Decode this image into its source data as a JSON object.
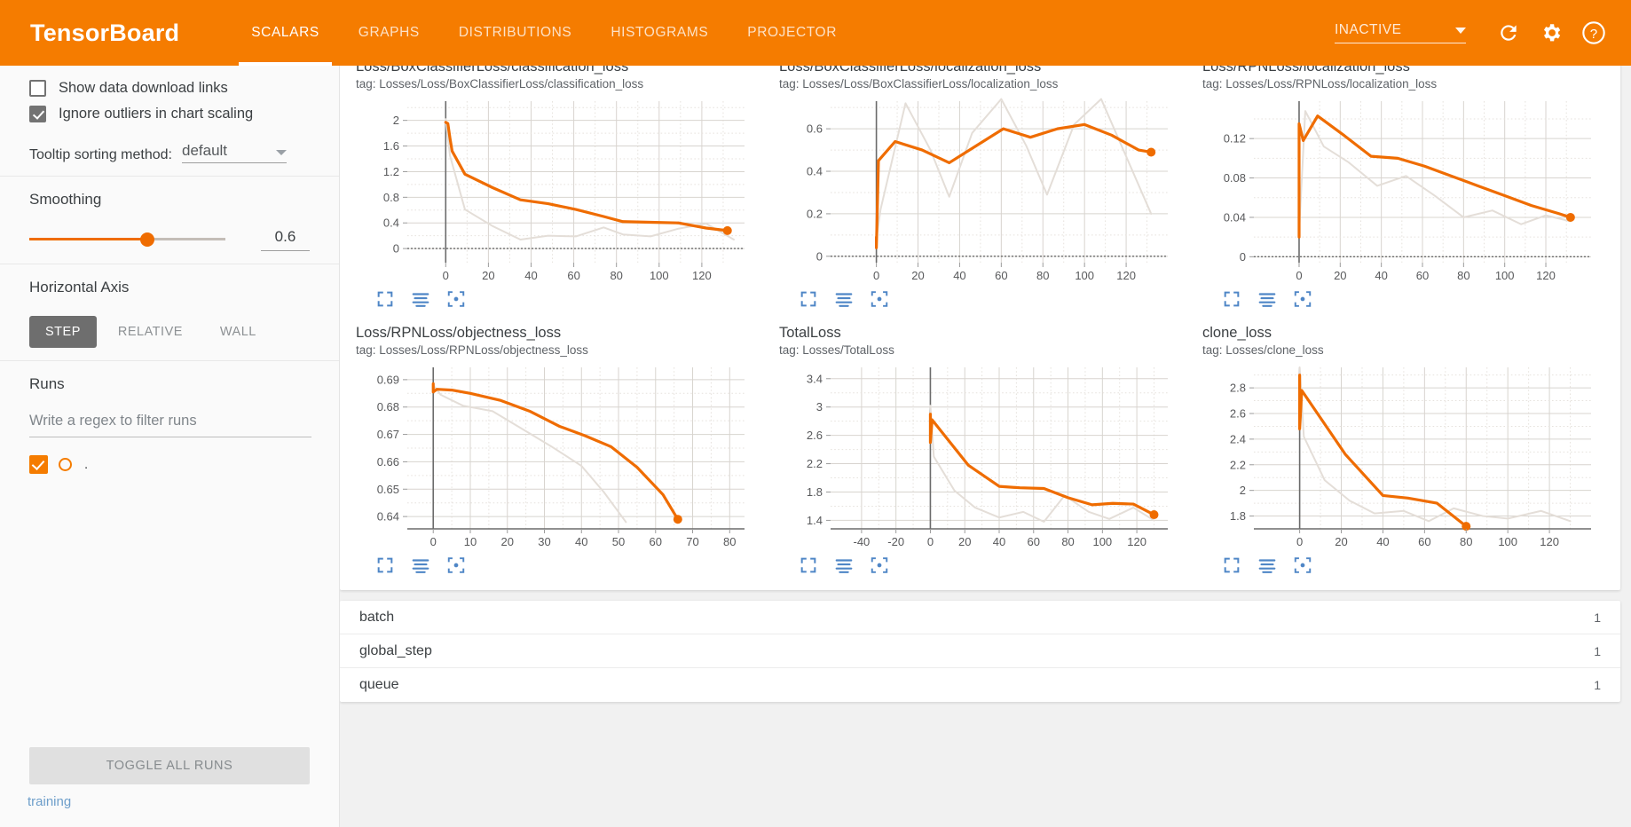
{
  "app": {
    "brand": "TensorBoard",
    "accent": "#f57c00",
    "line_color": "#ef6c00"
  },
  "header": {
    "tabs": [
      {
        "label": "SCALARS",
        "active": true
      },
      {
        "label": "GRAPHS",
        "active": false
      },
      {
        "label": "DISTRIBUTIONS",
        "active": false
      },
      {
        "label": "HISTOGRAMS",
        "active": false
      },
      {
        "label": "PROJECTOR",
        "active": false
      }
    ],
    "status_select": {
      "value": "INACTIVE",
      "icon": "chevron-down-icon"
    },
    "refresh_icon": "refresh-icon",
    "settings_icon": "gear-icon",
    "help_icon": "help-icon"
  },
  "sidebar": {
    "show_data_download_links": {
      "label": "Show data download links",
      "checked": false
    },
    "ignore_outliers": {
      "label": "Ignore outliers in chart scaling",
      "checked": true
    },
    "tooltip_sorting": {
      "label": "Tooltip sorting method:",
      "value": "default"
    },
    "smoothing": {
      "title": "Smoothing",
      "value": "0.6",
      "percent": 60
    },
    "horizontal_axis": {
      "title": "Horizontal Axis",
      "options": [
        {
          "label": "STEP",
          "active": true
        },
        {
          "label": "RELATIVE",
          "active": false
        },
        {
          "label": "WALL",
          "active": false
        }
      ]
    },
    "runs": {
      "title": "Runs",
      "filter_placeholder": "Write a regex to filter runs",
      "filter_value": "",
      "items": [
        {
          "name": ".",
          "checked": true
        }
      ],
      "toggle_all_label": "TOGGLE ALL RUNS",
      "training_link": "training"
    }
  },
  "chart_data": [
    {
      "type": "line",
      "title": "Loss/BoxClassifierLoss/classification_loss",
      "tag": "tag: Losses/Loss/BoxClassifierLoss/classification_loss",
      "xlabel": "",
      "ylabel": "",
      "xticks": [
        0,
        20,
        40,
        60,
        80,
        100,
        120
      ],
      "yticks": [
        0,
        0.4,
        0.8,
        1.2,
        1.6,
        2
      ],
      "xlim": [
        -18,
        140
      ],
      "ylim": [
        -0.22,
        2.3
      ],
      "grid": true,
      "legend": "none",
      "series": [
        {
          "name": "smoothed",
          "style": "solid",
          "x": [
            0,
            1,
            2,
            3,
            9,
            22,
            35,
            48,
            61,
            74,
            83,
            96,
            109,
            122,
            132
          ],
          "values": [
            1.97,
            1.95,
            1.72,
            1.52,
            1.16,
            0.95,
            0.76,
            0.7,
            0.61,
            0.5,
            0.42,
            0.41,
            0.4,
            0.32,
            0.28
          ]
        },
        {
          "name": "raw",
          "style": "faded",
          "x": [
            0,
            2,
            9,
            22,
            35,
            48,
            61,
            74,
            83,
            96,
            109,
            122,
            135
          ],
          "values": [
            2.02,
            1.45,
            0.61,
            0.35,
            0.14,
            0.2,
            0.19,
            0.33,
            0.22,
            0.19,
            0.31,
            0.39,
            0.14
          ]
        }
      ]
    },
    {
      "type": "line",
      "title": "Loss/BoxClassifierLoss/localization_loss",
      "tag": "tag: Losses/Loss/BoxClassifierLoss/localization_loss",
      "xlabel": "",
      "ylabel": "",
      "xticks": [
        0,
        20,
        40,
        60,
        80,
        100,
        120
      ],
      "yticks": [
        0,
        0.2,
        0.4,
        0.6
      ],
      "xlim": [
        -22,
        140
      ],
      "ylim": [
        -0.03,
        0.73
      ],
      "grid": true,
      "legend": "none",
      "series": [
        {
          "name": "smoothed",
          "style": "solid",
          "x": [
            0,
            0,
            1,
            9,
            22,
            35,
            48,
            61,
            74,
            87,
            100,
            113,
            126,
            132
          ],
          "values": [
            0.09,
            0.04,
            0.45,
            0.54,
            0.5,
            0.44,
            0.52,
            0.6,
            0.56,
            0.6,
            0.62,
            0.57,
            0.5,
            0.49
          ]
        },
        {
          "name": "raw",
          "style": "faded",
          "x": [
            0,
            2,
            14,
            26,
            35,
            46,
            60,
            72,
            82,
            95,
            108,
            120,
            132
          ],
          "values": [
            0.08,
            0.22,
            0.72,
            0.5,
            0.28,
            0.58,
            0.74,
            0.52,
            0.29,
            0.62,
            0.74,
            0.47,
            0.2
          ]
        }
      ]
    },
    {
      "type": "line",
      "title": "Loss/RPNLoss/localization_loss",
      "tag": "tag: Losses/Loss/RPNLoss/localization_loss",
      "xlabel": "",
      "ylabel": "",
      "xticks": [
        0,
        20,
        40,
        60,
        80,
        100,
        120
      ],
      "yticks": [
        0,
        0.04,
        0.08,
        0.12
      ],
      "xlim": [
        -22,
        142
      ],
      "ylim": [
        -0.006,
        0.158
      ],
      "grid": true,
      "legend": "none",
      "series": [
        {
          "name": "smoothed",
          "style": "solid",
          "x": [
            0,
            0,
            0,
            2,
            9,
            22,
            35,
            48,
            61,
            74,
            87,
            100,
            113,
            126,
            132
          ],
          "values": [
            0.02,
            0.075,
            0.135,
            0.118,
            0.143,
            0.123,
            0.102,
            0.1,
            0.092,
            0.082,
            0.072,
            0.062,
            0.052,
            0.044,
            0.04
          ]
        },
        {
          "name": "raw",
          "style": "faded",
          "x": [
            0,
            3,
            12,
            24,
            38,
            52,
            66,
            80,
            94,
            108,
            120,
            132
          ],
          "values": [
            0.025,
            0.148,
            0.112,
            0.096,
            0.072,
            0.082,
            0.062,
            0.04,
            0.047,
            0.033,
            0.042,
            0.036
          ]
        }
      ]
    },
    {
      "type": "line",
      "title": "Loss/RPNLoss/objectness_loss",
      "tag": "tag: Losses/Loss/RPNLoss/objectness_loss",
      "xlabel": "",
      "ylabel": "",
      "xticks": [
        0,
        10,
        20,
        30,
        40,
        50,
        60,
        70,
        80
      ],
      "yticks": [
        0.64,
        0.65,
        0.66,
        0.67,
        0.68,
        0.69
      ],
      "xlim": [
        -7,
        84
      ],
      "ylim": [
        0.6355,
        0.6945
      ],
      "grid": true,
      "legend": "none",
      "series": [
        {
          "name": "smoothed",
          "style": "solid",
          "x": [
            0,
            0,
            1,
            5,
            10,
            18,
            26,
            34,
            41,
            48,
            55,
            62,
            66
          ],
          "values": [
            0.6885,
            0.6855,
            0.6865,
            0.6862,
            0.685,
            0.6825,
            0.6785,
            0.673,
            0.6695,
            0.6655,
            0.658,
            0.648,
            0.639
          ]
        },
        {
          "name": "raw",
          "style": "faded",
          "x": [
            0,
            2,
            8,
            16,
            24,
            32,
            40,
            46,
            52
          ],
          "values": [
            0.688,
            0.6845,
            0.6805,
            0.6785,
            0.672,
            0.6655,
            0.6585,
            0.649,
            0.638
          ]
        }
      ]
    },
    {
      "type": "line",
      "title": "TotalLoss",
      "tag": "tag: Losses/TotalLoss",
      "xlabel": "",
      "ylabel": "",
      "xticks": [
        -40,
        -20,
        0,
        20,
        40,
        60,
        80,
        100,
        120
      ],
      "yticks": [
        1.4,
        1.8,
        2.2,
        2.6,
        3,
        3.4
      ],
      "xlim": [
        -58,
        138
      ],
      "ylim": [
        1.28,
        3.56
      ],
      "grid": true,
      "legend": "none",
      "series": [
        {
          "name": "smoothed",
          "style": "solid",
          "x": [
            0,
            0,
            1,
            22,
            40,
            52,
            66,
            80,
            94,
            106,
            118,
            130
          ],
          "values": [
            2.9,
            2.5,
            2.82,
            2.18,
            1.88,
            1.86,
            1.85,
            1.72,
            1.62,
            1.64,
            1.63,
            1.48
          ]
        },
        {
          "name": "raw",
          "style": "faded",
          "x": [
            0,
            2,
            14,
            26,
            40,
            54,
            66,
            78,
            92,
            104,
            118,
            130
          ],
          "values": [
            3.02,
            2.3,
            1.82,
            1.58,
            1.44,
            1.52,
            1.38,
            1.75,
            1.52,
            1.42,
            1.58,
            1.4
          ]
        }
      ]
    },
    {
      "type": "line",
      "title": "clone_loss",
      "tag": "tag: Losses/clone_loss",
      "xlabel": "",
      "ylabel": "",
      "xticks": [
        0,
        20,
        40,
        60,
        80,
        100,
        120
      ],
      "yticks": [
        1.8,
        2,
        2.2,
        2.4,
        2.6,
        2.8
      ],
      "xlim": [
        -22,
        140
      ],
      "ylim": [
        1.7,
        2.96
      ],
      "grid": true,
      "legend": "none",
      "series": [
        {
          "name": "smoothed",
          "style": "solid",
          "x": [
            0,
            0,
            1,
            22,
            40,
            52,
            66,
            80
          ],
          "values": [
            2.9,
            2.48,
            2.78,
            2.28,
            1.96,
            1.94,
            1.9,
            1.72
          ]
        },
        {
          "name": "raw",
          "style": "faded",
          "x": [
            0,
            2,
            12,
            24,
            36,
            50,
            62,
            74,
            88,
            100,
            116,
            130
          ],
          "values": [
            2.96,
            2.42,
            2.08,
            1.92,
            1.82,
            1.84,
            1.76,
            1.86,
            1.8,
            1.78,
            1.84,
            1.76
          ]
        }
      ]
    }
  ],
  "chart_actions": {
    "expand": "expand-icon",
    "lines": "data-series-icon",
    "fit": "fit-domain-icon"
  },
  "bottom_list": {
    "rows": [
      {
        "name": "batch",
        "count": "1"
      },
      {
        "name": "global_step",
        "count": "1"
      },
      {
        "name": "queue",
        "count": "1"
      }
    ]
  }
}
